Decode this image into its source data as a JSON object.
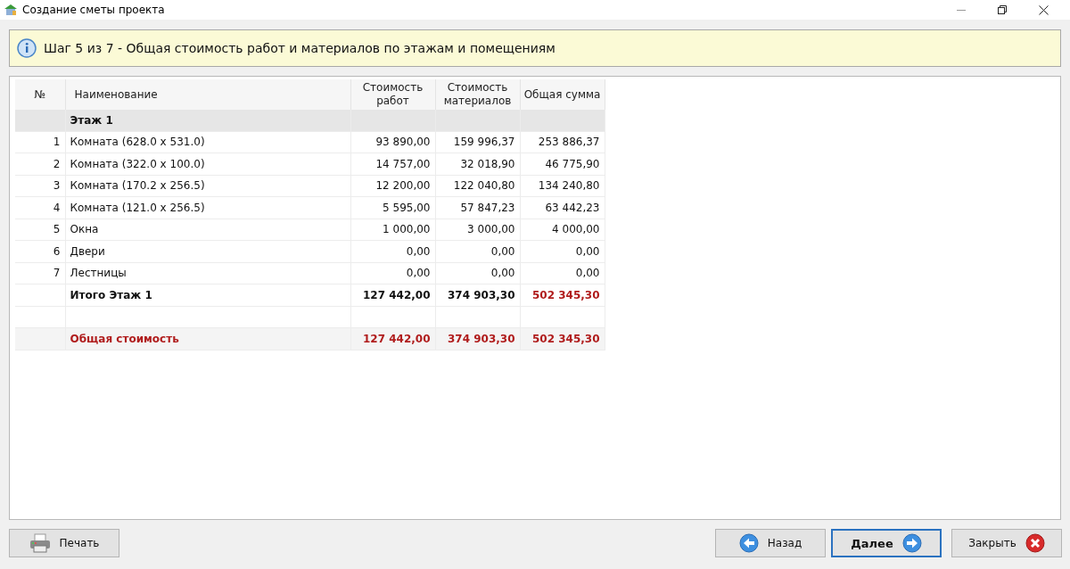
{
  "window": {
    "title": "Создание сметы проекта"
  },
  "banner": {
    "text": "Шаг 5 из 7 - Общая стоимость работ и материалов по этажам и помещениям"
  },
  "table": {
    "columns": [
      "№",
      "Наименование",
      "Стоимость работ",
      "Стоимость материалов",
      "Общая сумма"
    ],
    "rows": [
      {
        "kind": "group",
        "number": "",
        "name": "Этаж 1",
        "works": "",
        "materials": "",
        "total": ""
      },
      {
        "kind": "item",
        "number": "1",
        "name": "Комната (628.0 x 531.0)",
        "works": "93 890,00",
        "materials": "159 996,37",
        "total": "253 886,37"
      },
      {
        "kind": "item",
        "number": "2",
        "name": "Комната (322.0 x 100.0)",
        "works": "14 757,00",
        "materials": "32 018,90",
        "total": "46 775,90"
      },
      {
        "kind": "item",
        "number": "3",
        "name": "Комната (170.2 x 256.5)",
        "works": "12 200,00",
        "materials": "122 040,80",
        "total": "134 240,80"
      },
      {
        "kind": "item",
        "number": "4",
        "name": "Комната (121.0 x 256.5)",
        "works": "5 595,00",
        "materials": "57 847,23",
        "total": "63 442,23"
      },
      {
        "kind": "item",
        "number": "5",
        "name": "Окна",
        "works": "1 000,00",
        "materials": "3 000,00",
        "total": "4 000,00"
      },
      {
        "kind": "item",
        "number": "6",
        "name": "Двери",
        "works": "0,00",
        "materials": "0,00",
        "total": "0,00"
      },
      {
        "kind": "item",
        "number": "7",
        "name": "Лестницы",
        "works": "0,00",
        "materials": "0,00",
        "total": "0,00"
      },
      {
        "kind": "subtotal",
        "number": "",
        "name": "Итого Этаж 1",
        "works": "127 442,00",
        "materials": "374 903,30",
        "total": "502 345,30"
      },
      {
        "kind": "blank",
        "number": "",
        "name": "",
        "works": "",
        "materials": "",
        "total": ""
      },
      {
        "kind": "total",
        "number": "",
        "name": "Общая стоимость",
        "works": "127 442,00",
        "materials": "374 903,30",
        "total": "502 345,30"
      }
    ]
  },
  "buttons": [
    {
      "kind": "print",
      "label": "Печать",
      "default": false
    },
    {
      "kind": "back",
      "label": "Назад",
      "default": false
    },
    {
      "kind": "next",
      "label": "Далее",
      "default": true
    },
    {
      "kind": "close",
      "label": "Закрыть",
      "default": false
    }
  ]
}
